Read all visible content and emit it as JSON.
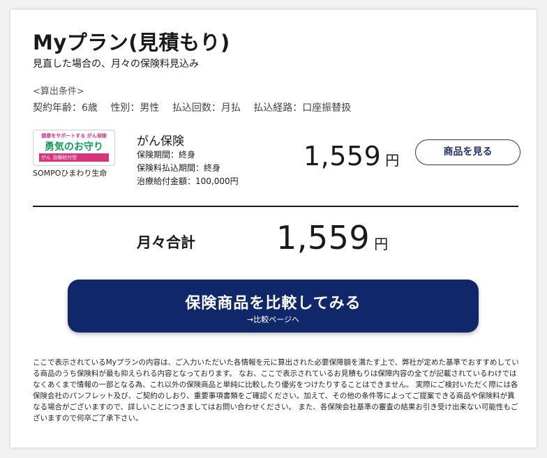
{
  "header": {
    "title": "Myプラン(見積もり)",
    "subtitle": "見直した場合の、月々の保険料見込み"
  },
  "conditions": {
    "heading": "<算出条件>",
    "age": "契約年齢：6歳",
    "gender": "性別：男性",
    "frequency": "払込回数：月払",
    "route": "払込経路：口座振替扱"
  },
  "product": {
    "logo_tagline": "健康をサポートする がん保険",
    "logo_name": "勇気のお守り",
    "logo_band": "がん 治療給付型",
    "company": "SOMPOひまわり生命",
    "name": "がん保険",
    "period": "保険期間：終身",
    "payment_period": "保険料払込期間：終身",
    "benefit": "治療給付金額：100,000円",
    "price": "1,559",
    "price_unit": "円",
    "detail_button": "商品を見る"
  },
  "total": {
    "label": "月々合計",
    "price": "1,559",
    "unit": "円"
  },
  "compare": {
    "main": "保険商品を比較してみる",
    "sub": "→比較ページへ"
  },
  "disclaimer": "ここで表示されているMyプランの内容は、ご入力いただいた各情報を元に算出された必要保障額を満たす上で、弊社が定めた基準でおすすめしている商品のうち保険料が最も抑えられる内容となっております。 なお、ここで表示されているお見積もりは保障内容の全てが記載されているわけではなくあくまで情報の一部となる為、これ以外の保険商品と単純に比較したり優劣をつけたりすることはできません。 実際にご検討いただく際には各保険会社のパンフレット及び、ご契約のしおり、重要事項書類をご確認ください。加えて、その他の条件等によってご提案できる商品や保険料が異なる場合がございますので、詳しいことにつきましてはお問い合わせください。 また、各保険会社基準の審査の結果お引き受け出来ない可能性もございますので何卒ご了承下さい。",
  "colors": {
    "accent_navy": "#10286a",
    "logo_green": "#1a9a5a",
    "logo_pink": "#d4357b"
  }
}
